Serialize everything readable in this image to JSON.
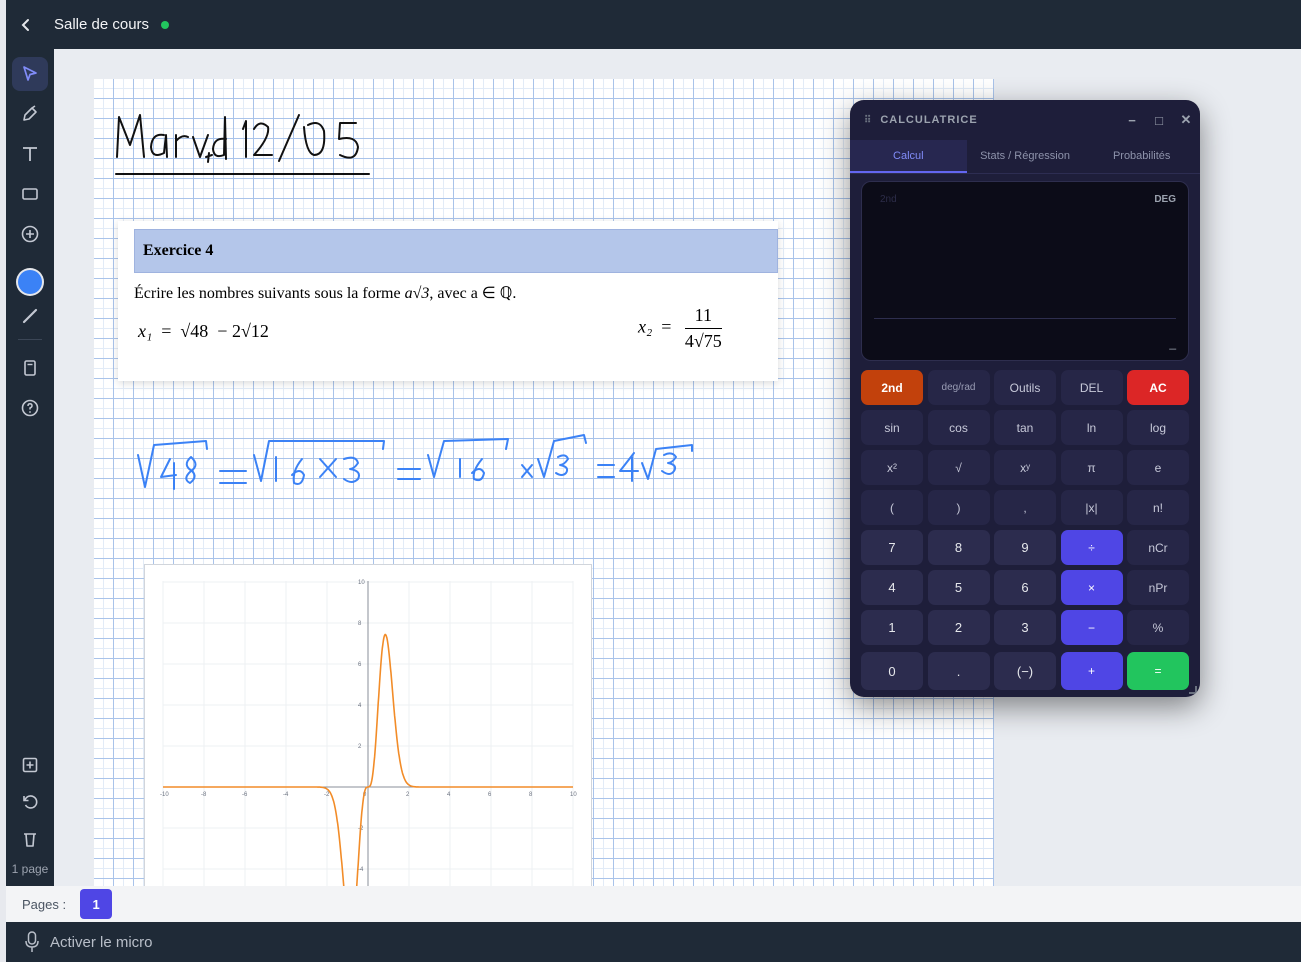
{
  "header": {
    "back_icon": "chevron-left-icon",
    "title": "Salle de cours",
    "status_color": "#22c55e"
  },
  "toolbar": {
    "tools": [
      "pointer-icon",
      "pen-icon",
      "text-icon",
      "rectangle-icon",
      "add-circle-icon",
      "color-picker",
      "line-icon",
      "document-icon",
      "help-icon",
      "add-page-icon",
      "undo-icon",
      "trash-icon"
    ],
    "current_color": "#3b82f6",
    "page_count_label": "1 page"
  },
  "sheet": {
    "handwritten_date": "Mardi 12/05",
    "exercise": {
      "heading": "Exercice 4",
      "statement_prefix": "Écrire les nombres suivants sous la forme ",
      "statement_form": "a√3",
      "statement_suffix": ", avec a ∈ ℚ.",
      "x1_label": "x₁",
      "x1_expr_a": "√48",
      "x1_minus": "− 2",
      "x1_expr_b": "√12",
      "x2_label": "x₂",
      "x2_num": "11",
      "x2_den_coef": "4",
      "x2_den_root": "√75"
    },
    "handwritten_calc": "√48 = √16×3 = √16 × √3 = 4√3",
    "graph": {
      "x_ticks": [
        "-10",
        "-8",
        "-6",
        "-4",
        "-2",
        "0",
        "2",
        "4",
        "6",
        "8",
        "10"
      ],
      "y_ticks": [
        "10",
        "8",
        "6",
        "4",
        "2",
        "-2",
        "-4"
      ],
      "curve_color": "#f28c28"
    }
  },
  "calculator": {
    "title": "CALCULATRICE",
    "tabs": [
      "Calcul",
      "Stats / Régression",
      "Probabilités"
    ],
    "active_tab": "Calcul",
    "display": {
      "second_indicator": "2nd",
      "angle_mode": "DEG",
      "cursor": "_"
    },
    "keys": [
      [
        "2nd",
        "deg/rad",
        "Outils",
        "DEL",
        "AC"
      ],
      [
        "sin",
        "cos",
        "tan",
        "ln",
        "log"
      ],
      [
        "x²",
        "√",
        "xʸ",
        "π",
        "e"
      ],
      [
        "(",
        ")",
        ",",
        "|x|",
        "n!"
      ],
      [
        "7",
        "8",
        "9",
        "÷",
        "nCr"
      ],
      [
        "4",
        "5",
        "6",
        "×",
        "nPr"
      ],
      [
        "1",
        "2",
        "3",
        "−",
        "%"
      ],
      [
        "0",
        ".",
        "(−)",
        "+",
        "="
      ]
    ]
  },
  "pages": {
    "label": "Pages :",
    "current": "1"
  },
  "mic": {
    "label": "Activer le micro"
  }
}
